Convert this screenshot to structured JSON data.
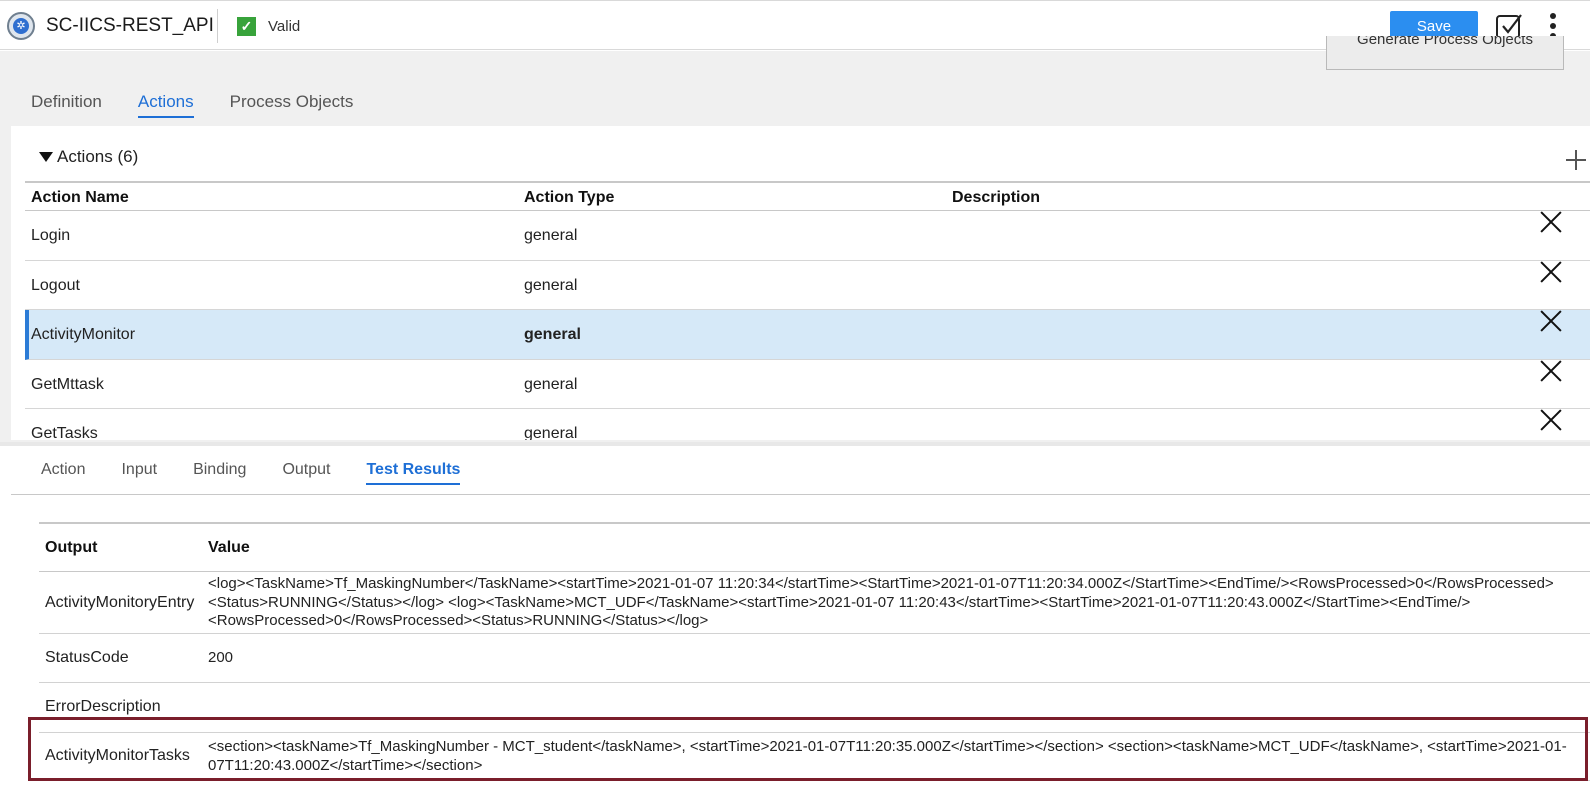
{
  "header": {
    "app_title": "SC-IICS-REST_API",
    "valid_label": "Valid",
    "save_label": "Save"
  },
  "top_tabs": [
    {
      "label": "Definition",
      "active": false
    },
    {
      "label": "Actions",
      "active": true
    },
    {
      "label": "Process Objects",
      "active": false
    }
  ],
  "actions": {
    "header": "Actions (6)",
    "columns": [
      "Action Name",
      "Action Type",
      "Description"
    ],
    "rows": [
      {
        "name": "Login",
        "type": "general",
        "description": ""
      },
      {
        "name": "Logout",
        "type": "general",
        "description": ""
      },
      {
        "name": "ActivityMonitor",
        "type": "general",
        "description": "",
        "selected": true
      },
      {
        "name": "GetMttask",
        "type": "general",
        "description": ""
      },
      {
        "name": "GetTasks",
        "type": "general",
        "description": ""
      }
    ]
  },
  "sub_tabs": [
    {
      "label": "Action",
      "active": false
    },
    {
      "label": "Input",
      "active": false
    },
    {
      "label": "Binding",
      "active": false
    },
    {
      "label": "Output",
      "active": false
    },
    {
      "label": "Test Results",
      "active": true
    }
  ],
  "generate_button": "Generate Process Objects",
  "results": {
    "columns": [
      "Output",
      "Value"
    ],
    "rows": [
      {
        "output": "ActivityMonitoryEntry",
        "value": "<log><TaskName>Tf_MaskingNumber</TaskName><startTime>2021-01-07 11:20:34</startTime><StartTime>2021-01-07T11:20:34.000Z</StartTime><EndTime/><RowsProcessed>0</RowsProcessed><Status>RUNNING</Status></log> <log><TaskName>MCT_UDF</TaskName><startTime>2021-01-07 11:20:43</startTime><StartTime>2021-01-07T11:20:43.000Z</StartTime><EndTime/><RowsProcessed>0</RowsProcessed><Status>RUNNING</Status></log>"
      },
      {
        "output": "StatusCode",
        "value": "200"
      },
      {
        "output": "ErrorDescription",
        "value": ""
      },
      {
        "output": "ActivityMonitorTasks",
        "value": "<section><taskName>Tf_MaskingNumber - MCT_student</taskName>, <startTime>2021-01-07T11:20:35.000Z</startTime></section> <section><taskName>MCT_UDF</taskName>, <startTime>2021-01-07T11:20:43.000Z</startTime></section>"
      }
    ]
  },
  "colors": {
    "accent": "#1e6fd6",
    "save_button": "#2b8ef0",
    "valid_green": "#38a33b",
    "selected_row": "#d6e9f8",
    "highlight_border": "#7a1e2b"
  }
}
